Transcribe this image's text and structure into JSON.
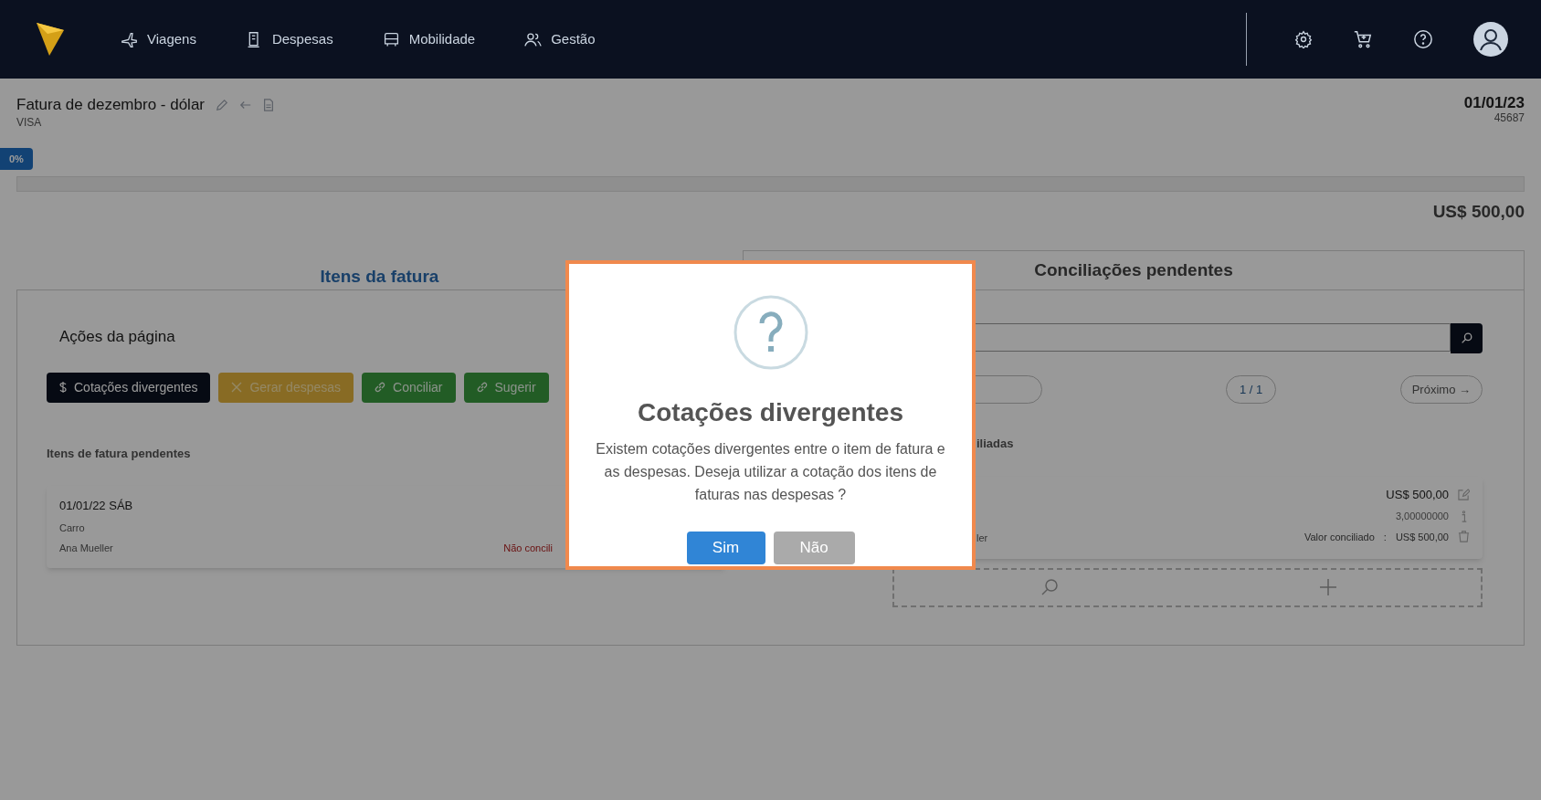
{
  "nav": {
    "items": [
      {
        "label": "Viagens"
      },
      {
        "label": "Despesas"
      },
      {
        "label": "Mobilidade"
      },
      {
        "label": "Gestão"
      }
    ]
  },
  "header": {
    "title": "Fatura de dezembro - dólar",
    "subtitle": "VISA",
    "date": "01/01/23",
    "number": "45687"
  },
  "progress": {
    "label": "0%",
    "level": 0
  },
  "total": "US$ 500,00",
  "tabs": [
    {
      "label": "Itens da fatura",
      "selected": true
    },
    {
      "label": "Conciliações pendentes",
      "selected": false
    }
  ],
  "left": {
    "actions_title": "Ações da página",
    "actions": [
      {
        "label": "Cotações divergentes"
      },
      {
        "label": "Gerar despesas"
      },
      {
        "label": "Conciliar"
      },
      {
        "label": "Sugerir"
      }
    ],
    "section_title": "Itens de fatura pendentes",
    "items": [
      {
        "date": "01/01/22 SÁB",
        "category": "Carro",
        "person": "Ana Mueller",
        "status": "Não concili"
      }
    ]
  },
  "right": {
    "pagination": {
      "page": "1 / 1",
      "next": "Próximo →"
    },
    "section_title": "iliadas",
    "items": [
      {
        "person": "ler",
        "amount": "US$ 500,00",
        "rate": "3,00000000",
        "reconciled_label": "Valor conciliado",
        "separator": ":",
        "reconciled_value": "US$ 500,00"
      }
    ]
  },
  "dialog": {
    "title": "Cotações divergentes",
    "message": "Existem cotações divergentes entre o item de fatura e as despesas. Deseja utilizar a cotação dos itens de faturas nas despesas ?",
    "buttons": [
      {
        "label": "Sim",
        "kind": "primary"
      },
      {
        "label": "Não",
        "kind": "secondary"
      }
    ]
  }
}
